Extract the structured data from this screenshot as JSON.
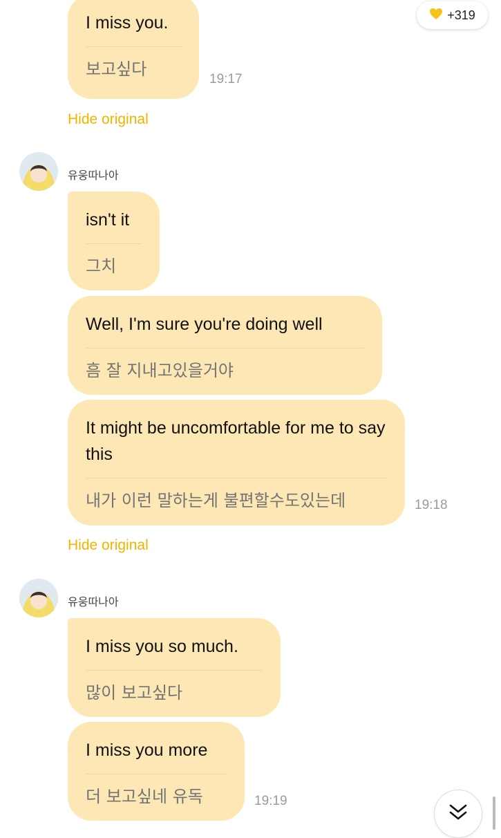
{
  "badge": {
    "icon": "heart-icon",
    "count": "+319"
  },
  "messages": [
    {
      "en": "I miss you.",
      "ko": "보고싶다"
    },
    {
      "sender": "유웅따나아",
      "en": "isn't it",
      "ko": "그치"
    },
    {
      "en": "Well, I'm sure you're doing well",
      "ko": "흠 잘 지내고있을거야"
    },
    {
      "en": "It might be uncomfortable for me to say this",
      "ko": "내가 이런 말하는게 불편할수도있는데"
    },
    {
      "sender": "유웅따나아",
      "en": "I miss you so much.",
      "ko": "많이 보고싶다"
    },
    {
      "en": "I miss you more",
      "ko": "더 보고싶네 유독"
    }
  ],
  "times": [
    "19:17",
    "19:18",
    "19:19"
  ],
  "hide_original": "Hide original",
  "sender_name": "유웅따나아",
  "colors": {
    "bubble": "#fde8b5",
    "accent": "#f0b400"
  }
}
